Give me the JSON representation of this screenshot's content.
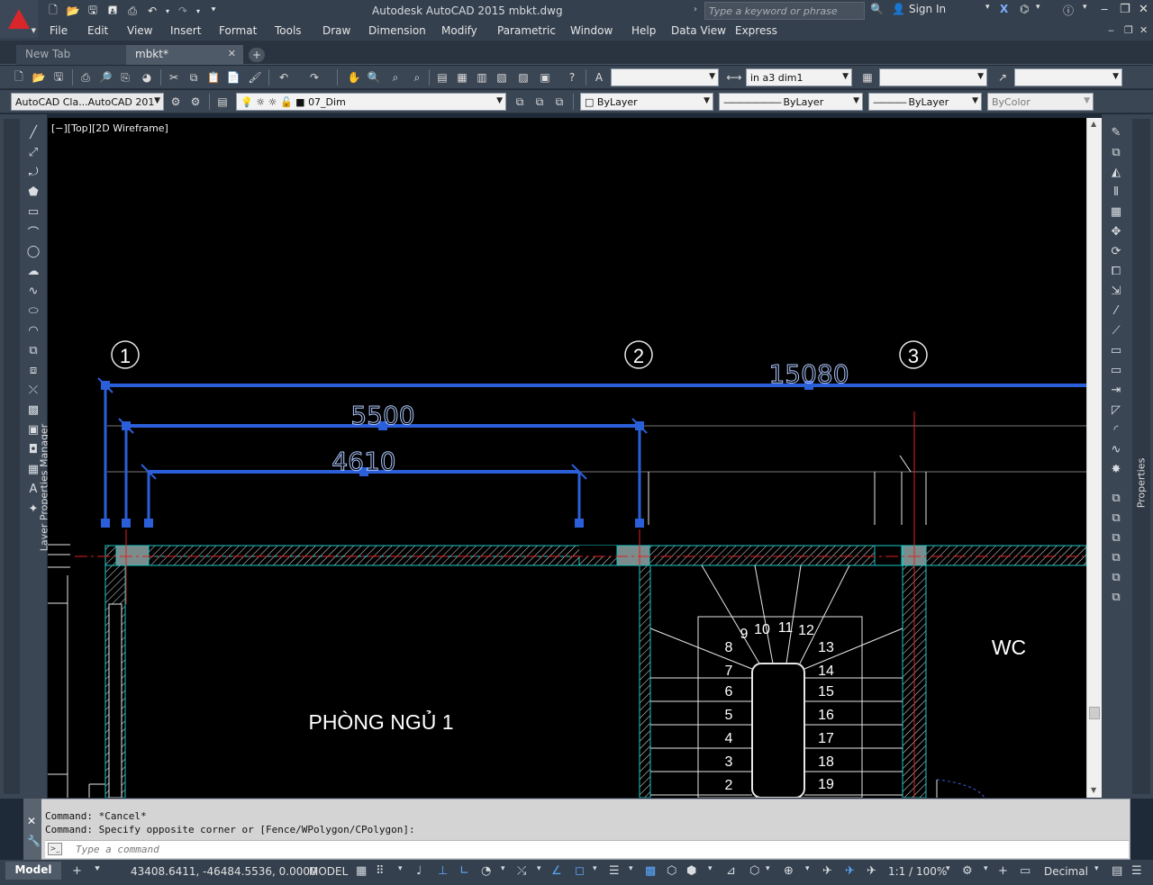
{
  "window": {
    "title": "Autodesk AutoCAD 2015    mbkt.dwg",
    "search_placeholder": "Type a keyword or phrase",
    "sign_in": "Sign In"
  },
  "menu": [
    "File",
    "Edit",
    "View",
    "Insert",
    "Format",
    "Tools",
    "Draw",
    "Dimension",
    "Modify",
    "Parametric",
    "Window",
    "Help",
    "Data View",
    "Express"
  ],
  "tabs": [
    {
      "label": "New Tab"
    },
    {
      "label": "mbkt*"
    }
  ],
  "toolbar1": {
    "dimstyle_value": "in a3 dim1",
    "combo1_value": "",
    "combo3_value": "",
    "combo4_value": ""
  },
  "toolbar2": {
    "workspace_value": "AutoCAD Cla...AutoCAD 201",
    "layer_value": "07_Dim",
    "color_value": "ByLayer",
    "linetype_value": "ByLayer",
    "lineweight_value": "ByLayer",
    "plotstyle_value": "ByColor"
  },
  "palettes": {
    "left_label": "Layer Properties Manager",
    "right_label": "Properties"
  },
  "viewport": {
    "label": "[−][Top][2D Wireframe]"
  },
  "drawing": {
    "grid_labels": [
      "1",
      "2",
      "3"
    ],
    "dimensions": [
      "15080",
      "5500",
      "4610"
    ],
    "room_labels": [
      "PHÒNG NGỦ 1",
      "WC"
    ],
    "stair_left": [
      "8",
      "7",
      "6",
      "5",
      "4",
      "3",
      "2"
    ],
    "stair_top": [
      "9",
      "10",
      "11",
      "12"
    ],
    "stair_right": [
      "13",
      "14",
      "15",
      "16",
      "17",
      "18",
      "19"
    ]
  },
  "command": {
    "history": [
      "Command: *Cancel*",
      "Command: Specify opposite corner or [Fence/WPolygon/CPolygon]:"
    ],
    "placeholder": "Type a command"
  },
  "status": {
    "layout_tab": "Model",
    "coordinates": "43408.6411, -46484.5536, 0.0000",
    "space": "MODEL",
    "annotation_scale": "1:1 / 100%",
    "units": "Decimal"
  },
  "colors": {
    "dimension": "#2b5fd9",
    "wall": "#17c7c7",
    "axis": "#e02020",
    "text": "#ffffff"
  }
}
